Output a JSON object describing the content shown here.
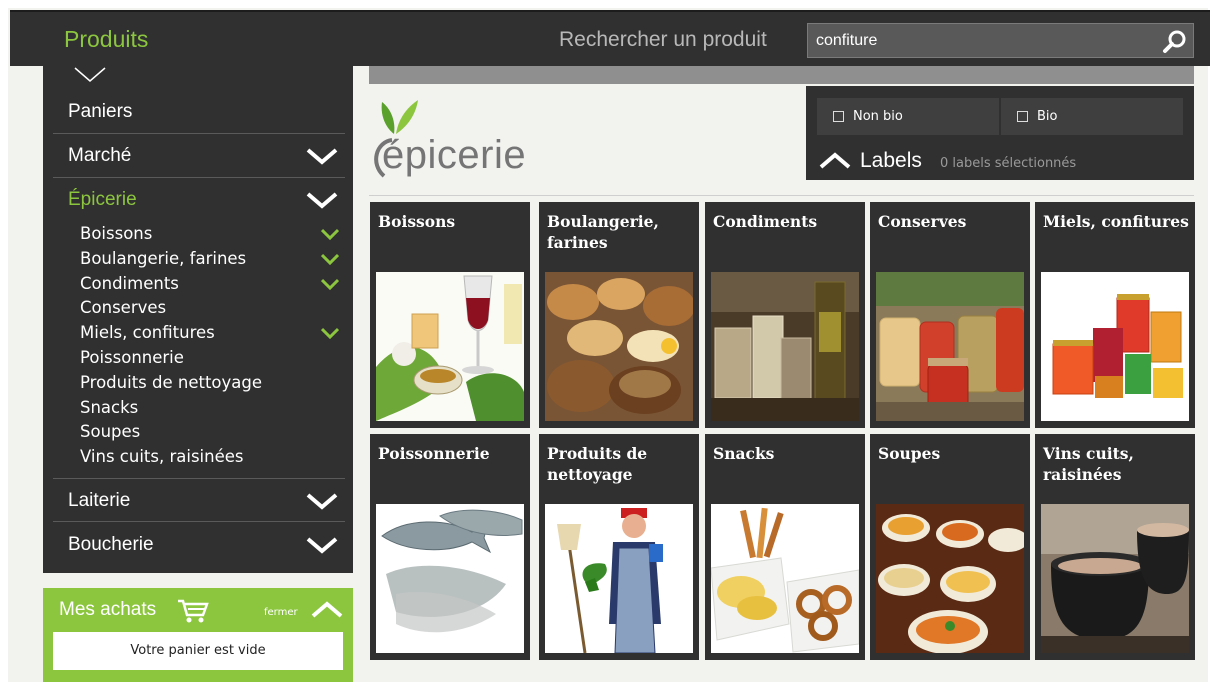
{
  "header": {
    "section_title": "Produits",
    "search_label": "Rechercher un produit",
    "search_value": "confiture"
  },
  "sidebar": {
    "categories": [
      {
        "label": "Paniers",
        "expandable": false
      },
      {
        "label": "Marché",
        "expandable": true
      },
      {
        "label": "Épicerie",
        "expandable": true,
        "active": true
      },
      {
        "label": "Laiterie",
        "expandable": true
      },
      {
        "label": "Boucherie",
        "expandable": true
      }
    ],
    "epicerie_items": [
      {
        "label": "Boissons",
        "checked": true
      },
      {
        "label": "Boulangerie, farines",
        "checked": true
      },
      {
        "label": "Condiments",
        "checked": true
      },
      {
        "label": "Conserves",
        "checked": false
      },
      {
        "label": "Miels, confitures",
        "checked": true
      },
      {
        "label": "Poissonnerie",
        "checked": false
      },
      {
        "label": "Produits de nettoyage",
        "checked": false
      },
      {
        "label": "Snacks",
        "checked": false
      },
      {
        "label": "Soupes",
        "checked": false
      },
      {
        "label": "Vins cuits, raisinées",
        "checked": false
      }
    ]
  },
  "cart": {
    "title": "Mes achats",
    "close_label": "fermer",
    "empty_message": "Votre panier est vide"
  },
  "main": {
    "logo_text": "épicerie",
    "filters": {
      "options": [
        {
          "label": "Non bio",
          "checked": false
        },
        {
          "label": "Bio",
          "checked": false
        }
      ],
      "labels_title": "Labels",
      "labels_count": "0 labels sélectionnés"
    },
    "tiles": [
      {
        "title": "Boissons",
        "icon": "drinks-photo"
      },
      {
        "title": "Boulangerie, farines",
        "icon": "bread-photo"
      },
      {
        "title": "Condiments",
        "icon": "condiment-jars-photo"
      },
      {
        "title": "Conserves",
        "icon": "preserve-jars-photo"
      },
      {
        "title": "Miels, confitures",
        "icon": "jam-jars-photo"
      },
      {
        "title": "Poissonnerie",
        "icon": "fish-photo"
      },
      {
        "title": "Produits de nettoyage",
        "icon": "cleaning-man-photo"
      },
      {
        "title": "Snacks",
        "icon": "snacks-photo"
      },
      {
        "title": "Soupes",
        "icon": "soup-cups-photo"
      },
      {
        "title": "Vins cuits, raisinées",
        "icon": "cauldron-photo"
      }
    ]
  },
  "colors": {
    "accent_green": "#8cc63f",
    "dark_panel": "#303030",
    "page_bg": "#f2f2ef"
  }
}
